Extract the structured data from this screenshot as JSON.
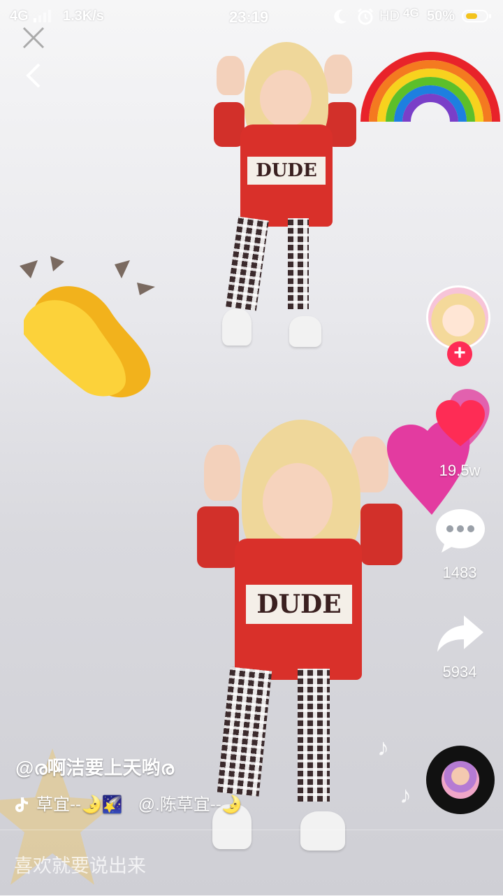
{
  "status_bar": {
    "network": "4G",
    "speed": "1.3K/s",
    "time": "23:19",
    "hd": "HD",
    "network_right": "4G",
    "battery": "50%",
    "battery_color": "#f3c31c"
  },
  "video": {
    "author": "@ര啊洁要上天哟ര",
    "music_icon": "♪",
    "music_text_1": "草宜--🌛🌠",
    "music_text_2": "@.陈草宜--🌛",
    "shirt_text": "DUDE"
  },
  "actions": {
    "likes": "19.5w",
    "comments": "1483",
    "shares": "5934",
    "follow_label": "+",
    "accent_color": "#fe2c55"
  },
  "comment_bar": {
    "placeholder": "喜欢就要说出来"
  }
}
